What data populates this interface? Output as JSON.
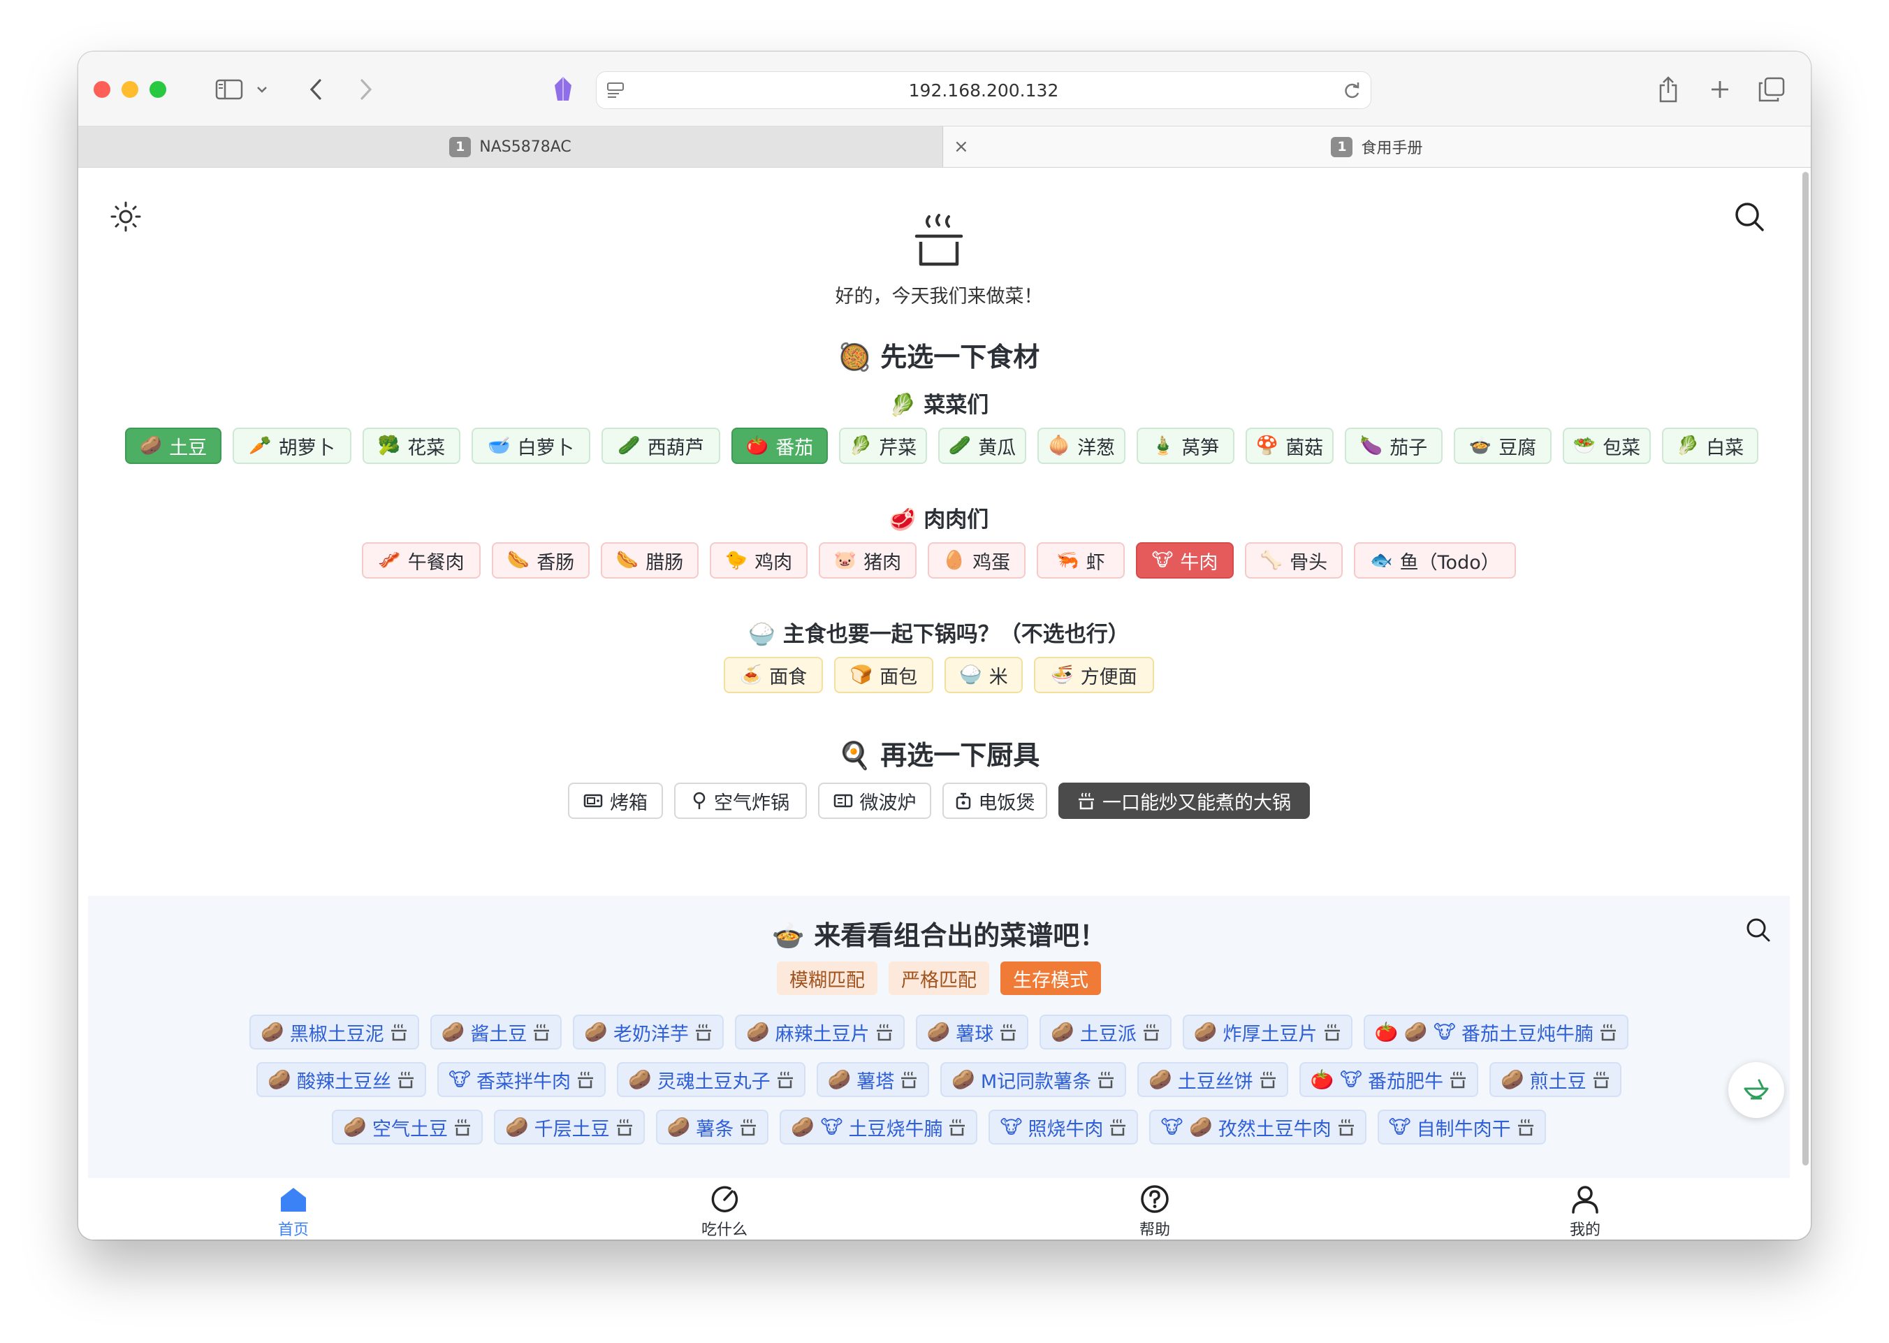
{
  "browser": {
    "url": "192.168.200.132",
    "tabs": [
      {
        "badge": "1",
        "title": "NAS5878AC"
      },
      {
        "badge": "1",
        "title": "食用手册"
      }
    ]
  },
  "page": {
    "greeting": "好的，今天我们来做菜！",
    "ingredients_title": "先选一下食材",
    "ingredients_emoji": "🥘",
    "veg_title": "菜菜们",
    "veg_emoji": "🥬",
    "vegetables": [
      {
        "emoji": "🥔",
        "label": "土豆",
        "selected": true
      },
      {
        "emoji": "🥕",
        "label": "胡萝卜",
        "selected": false
      },
      {
        "emoji": "🥦",
        "label": "花菜",
        "selected": false
      },
      {
        "emoji": "🥣",
        "label": "白萝卜",
        "selected": false
      },
      {
        "emoji": "🥒",
        "label": "西葫芦",
        "selected": false
      },
      {
        "emoji": "🍅",
        "label": "番茄",
        "selected": true
      },
      {
        "emoji": "🥬",
        "label": "芹菜",
        "selected": false
      },
      {
        "emoji": "🥒",
        "label": "黄瓜",
        "selected": false
      },
      {
        "emoji": "🧅",
        "label": "洋葱",
        "selected": false
      },
      {
        "emoji": "🎍",
        "label": "莴笋",
        "selected": false
      },
      {
        "emoji": "🍄",
        "label": "菌菇",
        "selected": false
      },
      {
        "emoji": "🍆",
        "label": "茄子",
        "selected": false
      },
      {
        "emoji": "🍲",
        "label": "豆腐",
        "selected": false
      },
      {
        "emoji": "🥗",
        "label": "包菜",
        "selected": false
      },
      {
        "emoji": "🥬",
        "label": "白菜",
        "selected": false
      }
    ],
    "meat_title": "肉肉们",
    "meat_emoji": "🥩",
    "meats": [
      {
        "emoji": "🥓",
        "label": "午餐肉",
        "selected": false
      },
      {
        "emoji": "🌭",
        "label": "香肠",
        "selected": false
      },
      {
        "emoji": "🌭",
        "label": "腊肠",
        "selected": false
      },
      {
        "emoji": "🐤",
        "label": "鸡肉",
        "selected": false
      },
      {
        "emoji": "🐷",
        "label": "猪肉",
        "selected": false
      },
      {
        "emoji": "🥚",
        "label": "鸡蛋",
        "selected": false
      },
      {
        "emoji": "🦐",
        "label": "虾",
        "selected": false
      },
      {
        "emoji": "🐮",
        "label": "牛肉",
        "selected": true
      },
      {
        "emoji": "🦴",
        "label": "骨头",
        "selected": false
      },
      {
        "emoji": "🐟",
        "label": "鱼（Todo）",
        "selected": false
      }
    ],
    "staple_title": "主食也要一起下锅吗？（不选也行）",
    "staple_emoji": "🍚",
    "staples": [
      {
        "emoji": "🍝",
        "label": "面食"
      },
      {
        "emoji": "🍞",
        "label": "面包"
      },
      {
        "emoji": "🍚",
        "label": "米"
      },
      {
        "emoji": "🍜",
        "label": "方便面"
      }
    ],
    "tools_title": "再选一下厨具",
    "tools_emoji": "🍳",
    "tools": [
      {
        "icon": "oven-icon",
        "label": "烤箱",
        "selected": false
      },
      {
        "icon": "air-fryer-icon",
        "label": "空气炸锅",
        "selected": false
      },
      {
        "icon": "microwave-icon",
        "label": "微波炉",
        "selected": false
      },
      {
        "icon": "rice-cooker-icon",
        "label": "电饭煲",
        "selected": false
      },
      {
        "icon": "pot-icon",
        "label": "一口能炒又能煮的大锅",
        "selected": true
      }
    ],
    "recipes_title": "来看看组合出的菜谱吧！",
    "recipes_emoji": "🍲",
    "modes": [
      {
        "label": "模糊匹配",
        "selected": false
      },
      {
        "label": "严格匹配",
        "selected": false
      },
      {
        "label": "生存模式",
        "selected": true
      }
    ],
    "recipes": [
      [
        {
          "emojis": "🥔",
          "label": "黑椒土豆泥"
        },
        {
          "emojis": "🥔",
          "label": "酱土豆"
        },
        {
          "emojis": "🥔",
          "label": "老奶洋芋"
        },
        {
          "emojis": "🥔",
          "label": "麻辣土豆片"
        },
        {
          "emojis": "🥔",
          "label": "薯球"
        },
        {
          "emojis": "🥔",
          "label": "土豆派"
        },
        {
          "emojis": "🥔",
          "label": "炸厚土豆片"
        },
        {
          "emojis": "🍅 🥔 🐮",
          "label": "番茄土豆炖牛腩"
        }
      ],
      [
        {
          "emojis": "🥔",
          "label": "酸辣土豆丝"
        },
        {
          "emojis": "🐮",
          "label": "香菜拌牛肉"
        },
        {
          "emojis": "🥔",
          "label": "灵魂土豆丸子"
        },
        {
          "emojis": "🥔",
          "label": "薯塔"
        },
        {
          "emojis": "🥔",
          "label": "M记同款薯条"
        },
        {
          "emojis": "🥔",
          "label": "土豆丝饼"
        },
        {
          "emojis": "🍅 🐮",
          "label": "番茄肥牛"
        },
        {
          "emojis": "🥔",
          "label": "煎土豆"
        }
      ],
      [
        {
          "emojis": "🥔",
          "label": "空气土豆"
        },
        {
          "emojis": "🥔",
          "label": "千层土豆"
        },
        {
          "emojis": "🥔",
          "label": "薯条"
        },
        {
          "emojis": "🥔 🐮",
          "label": "土豆烧牛腩"
        },
        {
          "emojis": "🐮",
          "label": "照烧牛肉"
        },
        {
          "emojis": "🐮 🥔",
          "label": "孜然土豆牛肉"
        },
        {
          "emojis": "🐮",
          "label": "自制牛肉干"
        }
      ]
    ],
    "nav": [
      {
        "icon": "home-icon",
        "label": "首页",
        "active": true
      },
      {
        "icon": "dice-icon",
        "label": "吃什么",
        "active": false
      },
      {
        "icon": "help-icon",
        "label": "帮助",
        "active": false
      },
      {
        "icon": "user-icon",
        "label": "我的",
        "active": false
      }
    ]
  },
  "colors": {
    "veg_selected": "#4caf63",
    "meat_selected": "#e55a5a",
    "tool_selected": "#4b4b4b",
    "mode_selected": "#ef7b37",
    "recipe_text": "#2f5fd6",
    "nav_active": "#3b82f6"
  }
}
